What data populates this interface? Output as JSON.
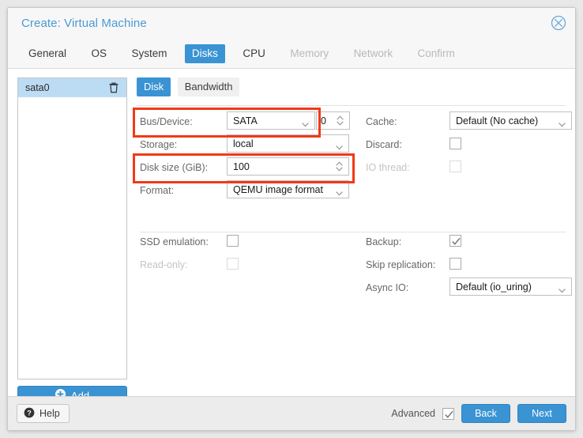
{
  "window": {
    "title": "Create: Virtual Machine",
    "close_icon": "close-circle-icon"
  },
  "wizard_tabs": [
    {
      "label": "General",
      "state": "enabled"
    },
    {
      "label": "OS",
      "state": "enabled"
    },
    {
      "label": "System",
      "state": "enabled"
    },
    {
      "label": "Disks",
      "state": "active"
    },
    {
      "label": "CPU",
      "state": "enabled"
    },
    {
      "label": "Memory",
      "state": "disabled"
    },
    {
      "label": "Network",
      "state": "disabled"
    },
    {
      "label": "Confirm",
      "state": "disabled"
    }
  ],
  "sidebar": {
    "devices": [
      {
        "name": "sata0",
        "selected": true,
        "delete_icon": "trash-icon"
      }
    ],
    "add_button": {
      "label": "Add",
      "icon": "plus-circle-icon"
    }
  },
  "panel": {
    "subtabs": [
      {
        "label": "Disk",
        "active": true
      },
      {
        "label": "Bandwidth",
        "active": false
      }
    ],
    "left_column": {
      "bus_device": {
        "label": "Bus/Device:",
        "value": "SATA",
        "index_value": "0",
        "highlighted": true
      },
      "storage": {
        "label": "Storage:",
        "value": "local"
      },
      "disk_size": {
        "label": "Disk size (GiB):",
        "value": "100",
        "highlighted": true
      },
      "format": {
        "label": "Format:",
        "value": "QEMU image format"
      },
      "ssd_emulation": {
        "label": "SSD emulation:",
        "checked": false,
        "disabled": false
      },
      "read_only": {
        "label": "Read-only:",
        "checked": false,
        "disabled": true
      }
    },
    "right_column": {
      "cache": {
        "label": "Cache:",
        "value": "Default (No cache)"
      },
      "discard": {
        "label": "Discard:",
        "checked": false,
        "disabled": false
      },
      "io_thread": {
        "label": "IO thread:",
        "checked": false,
        "disabled": true
      },
      "backup": {
        "label": "Backup:",
        "checked": true,
        "disabled": false
      },
      "skip_replication": {
        "label": "Skip replication:",
        "checked": false,
        "disabled": false
      },
      "async_io": {
        "label": "Async IO:",
        "value": "Default (io_uring)"
      }
    }
  },
  "footer": {
    "help": {
      "label": "Help",
      "icon": "question-circle-icon"
    },
    "advanced": {
      "label": "Advanced",
      "checked": true
    },
    "back": "Back",
    "next": "Next"
  },
  "colors": {
    "accent_blue": "#3a93d2",
    "title_blue": "#4a9ad4",
    "selection_blue": "#bcdcf4",
    "annotation_red": "#f03a17",
    "label_gray": "#676767",
    "disabled_gray": "#c4c4c4"
  }
}
